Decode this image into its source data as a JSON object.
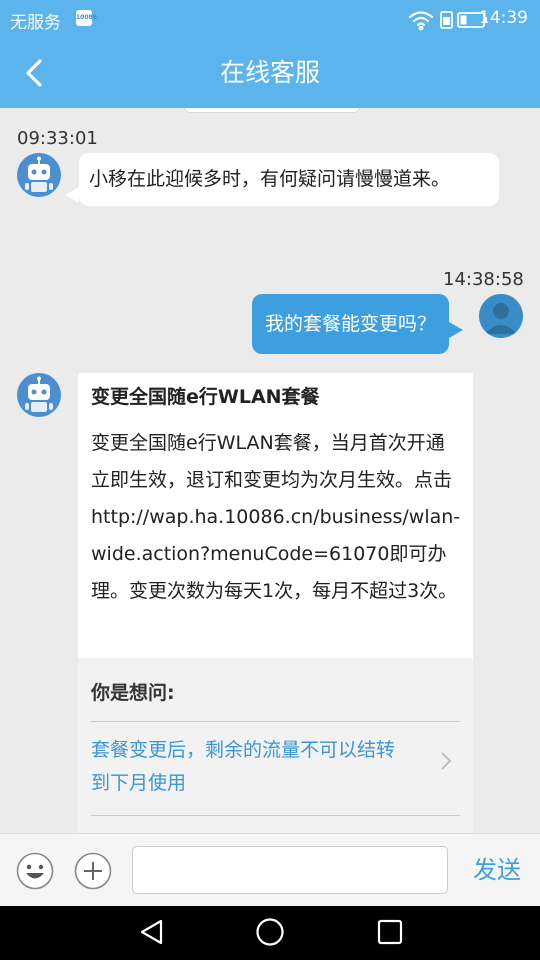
{
  "status_bar": {
    "carrier": "无服务",
    "sim_badge": "10086",
    "time": "14:39",
    "icons": [
      "wifi-icon",
      "sim-icon",
      "battery-icon"
    ]
  },
  "header": {
    "title": "在线客服",
    "back_icon": "back-icon"
  },
  "messages": [
    {
      "side": "left",
      "timestamp": "09:33:01",
      "avatar": "robot-avatar",
      "text": "小移在此迎候多时，有何疑问请慢慢道来。"
    },
    {
      "side": "right",
      "timestamp": "14:38:58",
      "avatar": "user-avatar",
      "text": "我的套餐能变更吗？"
    },
    {
      "side": "left",
      "avatar": "robot-avatar",
      "card_title": "变更全国随e行WLAN套餐",
      "text": "变更全国随e行WLAN套餐，当月首次开通立即生效，退订和变更均为次月生效。点击http://wap.ha.10086.cn/business/wlan-wide.action?menuCode=61070即可办理。变更次数为每天1次，每月不超过3次。",
      "suggest_heading": "你是想问:",
      "suggestions": [
        "套餐变更后，剩余的流量不可以结转到下月使用"
      ]
    }
  ],
  "input_bar": {
    "value": "",
    "placeholder": "",
    "send_label": "发送",
    "icons": [
      "emoji-icon",
      "plus-icon"
    ]
  },
  "nav_bar": {
    "icons": [
      "back-triangle-icon",
      "home-circle-icon",
      "recents-square-icon"
    ]
  },
  "colors": {
    "accent": "#5bb4ec",
    "user_bubble": "#3d9ee0",
    "link": "#3c96cf"
  }
}
